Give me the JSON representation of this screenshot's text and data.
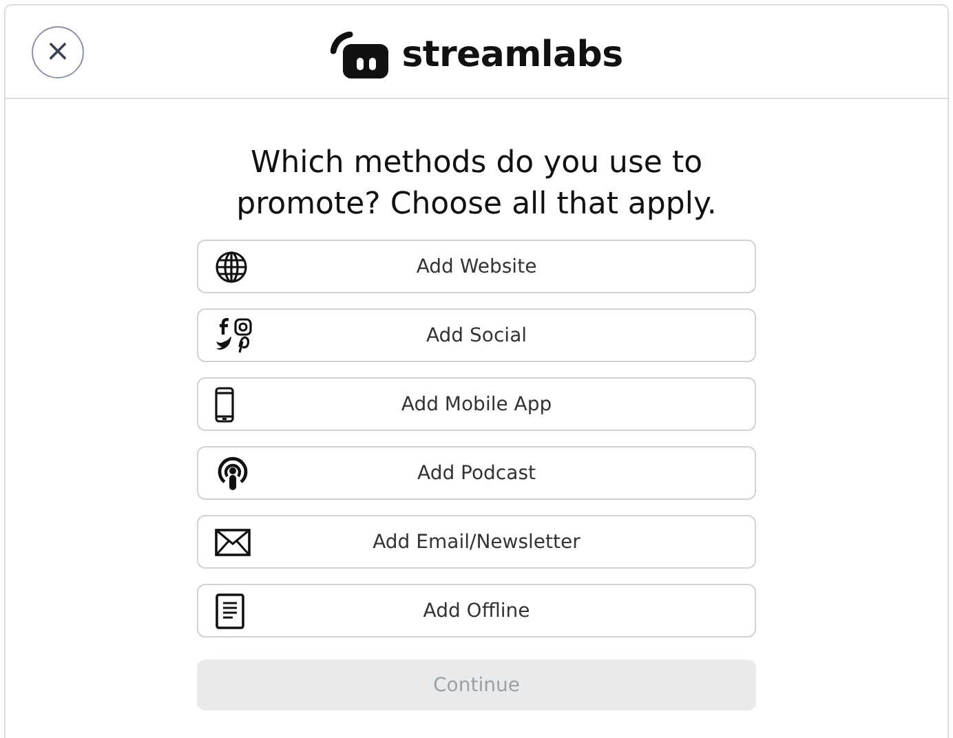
{
  "header": {
    "close_icon": "×",
    "logo_text": "streamlabs"
  },
  "question": "Which methods do you use to promote? Choose all that apply.",
  "options": [
    {
      "kind": "website",
      "label": "Add Website"
    },
    {
      "kind": "social",
      "label": "Add Social"
    },
    {
      "kind": "mobile",
      "label": "Add Mobile App"
    },
    {
      "kind": "podcast",
      "label": "Add Podcast"
    },
    {
      "kind": "email",
      "label": "Add Email/Newsletter"
    },
    {
      "kind": "offline",
      "label": "Add Offline"
    }
  ],
  "continue_button": {
    "label": "Continue",
    "disabled": true
  }
}
